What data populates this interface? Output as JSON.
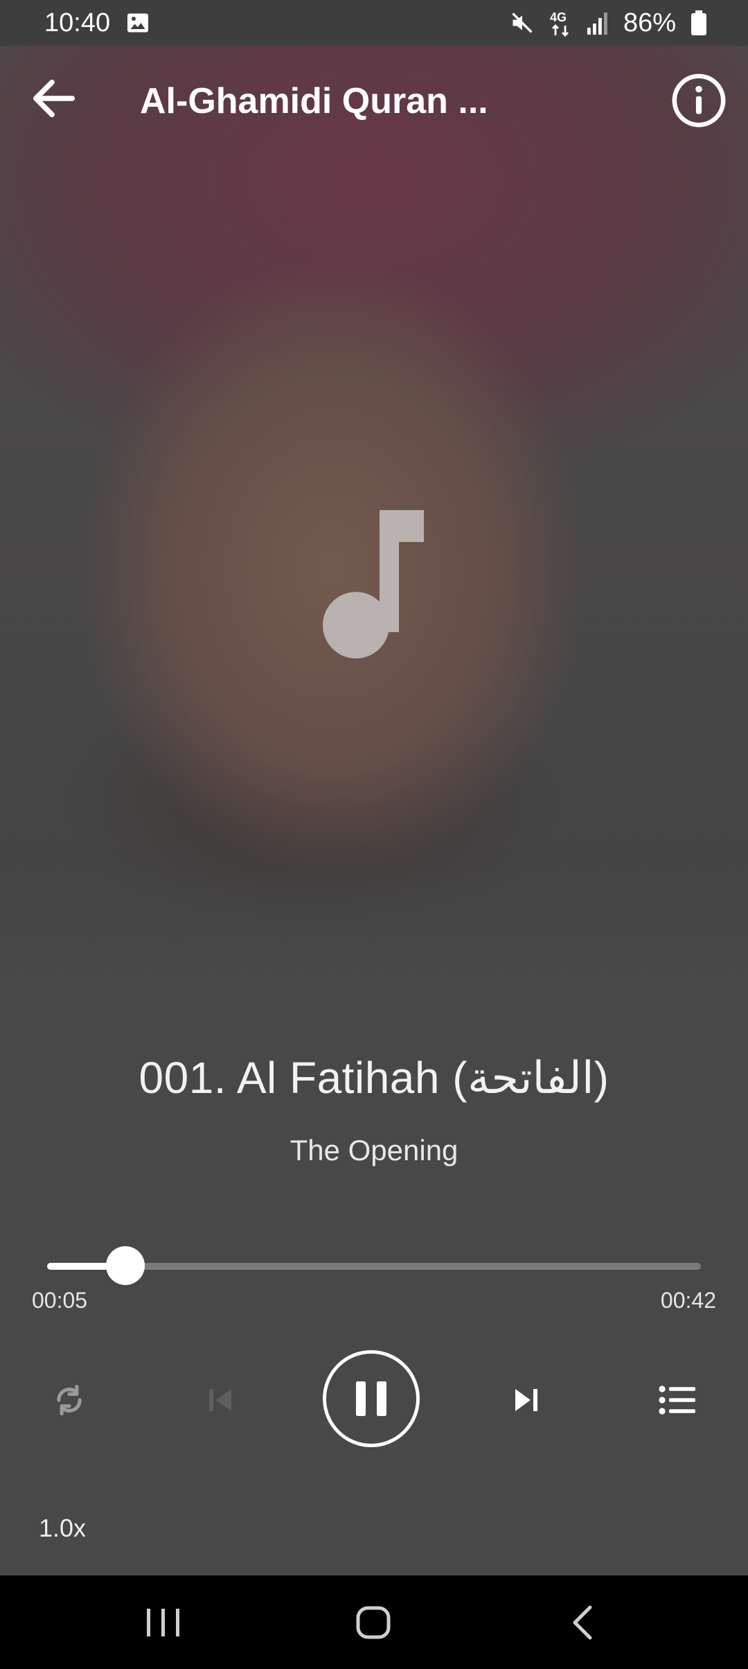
{
  "status_bar": {
    "time": "10:40",
    "network": "4G",
    "battery": "86%"
  },
  "app_bar": {
    "title": "Al-Ghamidi Quran ..."
  },
  "track": {
    "title": "001. Al Fatihah (الفاتحة)",
    "subtitle": "The Opening"
  },
  "player": {
    "elapsed": "00:05",
    "duration": "00:42",
    "progress_fraction": 0.12,
    "speed": "1.0x",
    "state": "playing"
  },
  "icons": {
    "back": "arrow-left-icon",
    "info": "info-icon",
    "note": "music-note-icon",
    "repeat": "repeat-icon",
    "previous": "skip-previous-icon",
    "pause": "pause-icon",
    "next": "skip-next-icon",
    "playlist": "playlist-icon"
  }
}
